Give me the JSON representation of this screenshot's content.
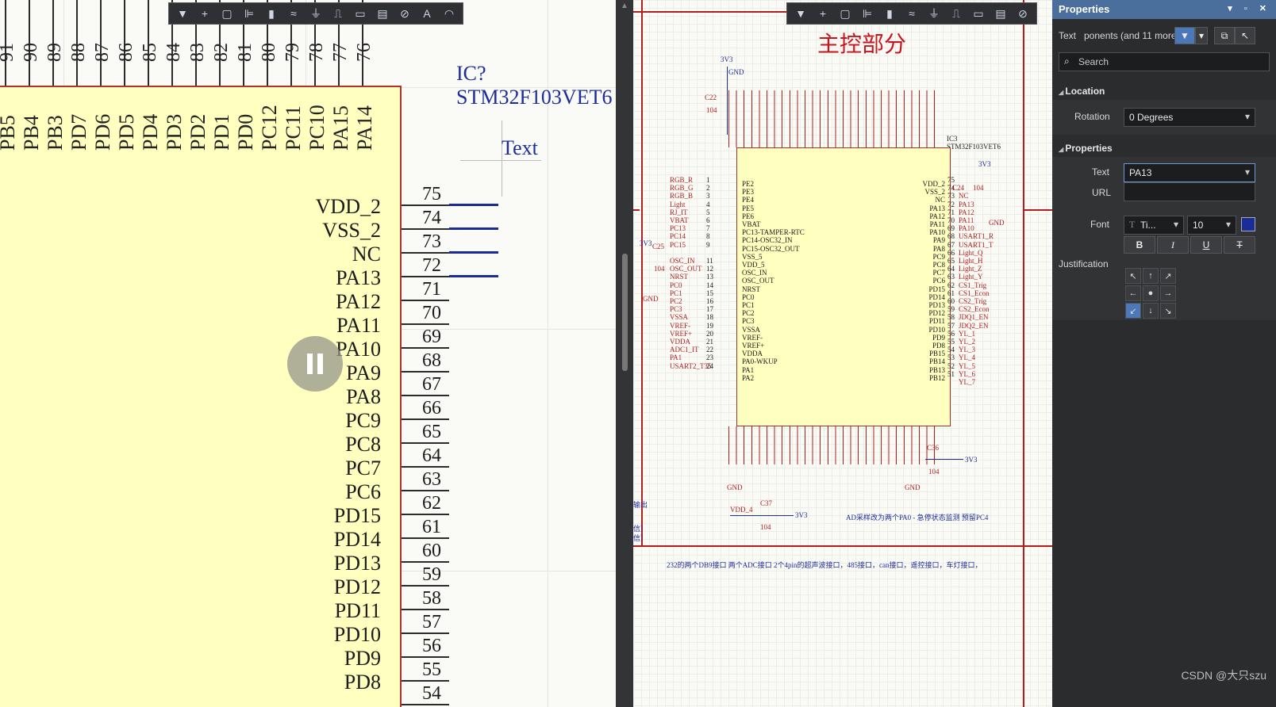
{
  "left_toolbar": [
    "filter-icon",
    "add-wire-icon",
    "select-rect-icon",
    "align-icon",
    "part-icon",
    "bus-icon",
    "power-icon",
    "netlabel-icon",
    "port-icon",
    "sheet-icon",
    "directive-icon",
    "text-icon",
    "arc-icon"
  ],
  "right_toolbar": [
    "filter-icon",
    "add-wire-icon",
    "select-rect-icon",
    "align-icon",
    "part-icon",
    "bus-icon",
    "power-icon",
    "netlabel-icon",
    "port-icon",
    "sheet-icon",
    "directive-icon"
  ],
  "top_pins": [
    {
      "num": "91",
      "name": "PB5"
    },
    {
      "num": "90",
      "name": "PB4"
    },
    {
      "num": "89",
      "name": "PB3"
    },
    {
      "num": "88",
      "name": "PD7"
    },
    {
      "num": "87",
      "name": "PD6"
    },
    {
      "num": "86",
      "name": "PD5"
    },
    {
      "num": "85",
      "name": "PD4"
    },
    {
      "num": "84",
      "name": "PD3"
    },
    {
      "num": "83",
      "name": "PD2"
    },
    {
      "num": "82",
      "name": "PD1"
    },
    {
      "num": "81",
      "name": "PD0"
    },
    {
      "num": "80",
      "name": "PC12"
    },
    {
      "num": "79",
      "name": "PC11"
    },
    {
      "num": "78",
      "name": "PC10"
    },
    {
      "num": "77",
      "name": "PA15"
    },
    {
      "num": "76",
      "name": "PA14"
    }
  ],
  "right_pins": [
    {
      "num": "75",
      "name": "VDD_2",
      "wire": true
    },
    {
      "num": "74",
      "name": "VSS_2",
      "wire": true
    },
    {
      "num": "73",
      "name": "NC",
      "wire": true
    },
    {
      "num": "72",
      "name": "PA13",
      "wire": true
    },
    {
      "num": "71",
      "name": "PA12"
    },
    {
      "num": "70",
      "name": "PA11"
    },
    {
      "num": "69",
      "name": "PA10"
    },
    {
      "num": "68",
      "name": "PA9"
    },
    {
      "num": "67",
      "name": "PA8"
    },
    {
      "num": "66",
      "name": "PC9"
    },
    {
      "num": "65",
      "name": "PC8"
    },
    {
      "num": "64",
      "name": "PC7"
    },
    {
      "num": "63",
      "name": "PC6"
    },
    {
      "num": "62",
      "name": "PD15"
    },
    {
      "num": "61",
      "name": "PD14"
    },
    {
      "num": "60",
      "name": "PD13"
    },
    {
      "num": "59",
      "name": "PD12"
    },
    {
      "num": "58",
      "name": "PD11"
    },
    {
      "num": "57",
      "name": "PD10"
    },
    {
      "num": "56",
      "name": "PD9"
    },
    {
      "num": "55",
      "name": "PD8"
    },
    {
      "num": "54",
      "name": ""
    }
  ],
  "ic_designator": "IC?",
  "ic_part": "STM32F103VET6",
  "text_object": "Text",
  "right": {
    "sheet_title": "主控部分",
    "ic3": "IC3",
    "ic3_part": "STM32F103VET6",
    "cap_c22": "C22",
    "cap_c22_val": "104",
    "cap_c24": "C24",
    "cap_c24_val": "104",
    "cap_c25": "C25",
    "cap_c25_val": "104",
    "cap_c36": "C36",
    "cap_c36_val": "104",
    "cap_c37": "C37",
    "cap_c37_val": "104",
    "v3v3": "3V3",
    "gnd": "GND",
    "vdd4": "VDD_4",
    "left_nets": [
      "RGB_R",
      "RGB_G",
      "RGB_B",
      "Light",
      "RJ_IT",
      "VBAT",
      "PC13",
      "PC14",
      "PC15",
      "",
      "OSC_IN",
      "OSC_OUT",
      "NRST",
      "PC0",
      "PC1",
      "PC2",
      "PC3",
      "VSSA",
      "VREF-",
      "VREF+",
      "VDDA",
      "ADC1_IT",
      "PA1",
      "USART2_T35"
    ],
    "left_pins": [
      "PE2",
      "PE3",
      "PE4",
      "PE5",
      "PE6",
      "VBAT",
      "PC13-TAMPER-RTC",
      "PC14-OSC32_IN",
      "PC15-OSC32_OUT",
      "VSS_5",
      "VDD_5",
      "OSC_IN",
      "OSC_OUT",
      "NRST",
      "PC0",
      "PC1",
      "PC2",
      "PC3",
      "VSSA",
      "VREF-",
      "VREF+",
      "VDDA",
      "PA0-WKUP",
      "PA1",
      "PA2"
    ],
    "right_pins": [
      "VDD_2",
      "VSS_2",
      "NC",
      "PA13",
      "PA12",
      "PA11",
      "PA10",
      "PA9",
      "PA8",
      "PC9",
      "PC8",
      "PC7",
      "PC6",
      "PD15",
      "PD14",
      "PD13",
      "PD12",
      "PD11",
      "PD10",
      "PD9",
      "PD8",
      "PB15",
      "PB14",
      "PB13",
      "PB12"
    ],
    "right_nets": [
      "",
      "",
      "NC",
      "PA13",
      "PA12",
      "PA11",
      "PA10",
      "USART1_R",
      "USART1_T",
      "Light_Q",
      "Light_H",
      "Light_Z",
      "Light_Y",
      "CS1_Trig",
      "CS1_Econ",
      "CS2_Trig",
      "CS2_Econ",
      "JDQ1_EN",
      "JDQ2_EN",
      "YL_1",
      "YL_2",
      "YL_3",
      "YL_4",
      "YL_5",
      "YL_6",
      "YL_7"
    ],
    "right_nums": [
      "75",
      "74",
      "73",
      "72",
      "71",
      "70",
      "69",
      "68",
      "67",
      "66",
      "65",
      "64",
      "63",
      "62",
      "61",
      "60",
      "59",
      "58",
      "57",
      "56",
      "55",
      "54",
      "53",
      "52",
      "51"
    ],
    "note1": "AD采样改为两个PA0 - 急停状态监测  预留PC4",
    "note2": "232的两个DB9接口 两个ADC接口 2个4pin的超声波接口，485接口，can接口，遥控接口，车灯接口，",
    "side_labels": [
      "输出",
      "信）",
      "信）"
    ]
  },
  "props": {
    "title": "Properties",
    "text_type": "Text",
    "components": "ponents (and 11 more)",
    "search_placeholder": "Search",
    "location_header": "Location",
    "rotation_label": "Rotation",
    "rotation_value": "0 Degrees",
    "properties_header": "Properties",
    "text_label": "Text",
    "text_value": "PA13",
    "url_label": "URL",
    "url_value": "",
    "font_label": "Font",
    "font_value": "Ti...",
    "font_size": "10",
    "font_color": "#1a2b9a",
    "bold": "B",
    "italic": "I",
    "underline": "U",
    "strike": "T",
    "justification_label": "Justification",
    "justification_selected": "bottom-left"
  },
  "watermark": "CSDN @大只szu"
}
